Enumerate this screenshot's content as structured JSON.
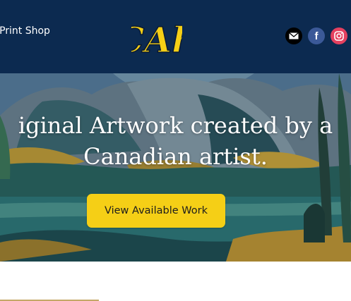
{
  "header": {
    "nav_link_label": "e Print Shop",
    "logo_text": "CAh",
    "social": {
      "email_icon": "email-icon",
      "facebook_glyph": "f",
      "instagram_icon": "instagram-icon"
    }
  },
  "hero": {
    "headline_line1": "iginal Artwork created by a",
    "headline_line2": "Canadian artist.",
    "cta_label": "View Available Work"
  },
  "colors": {
    "header_bg": "#0c2a50",
    "accent": "#f5cf16",
    "facebook": "#3b5998",
    "instagram": "#e4405f",
    "divider": "#c4a867"
  }
}
